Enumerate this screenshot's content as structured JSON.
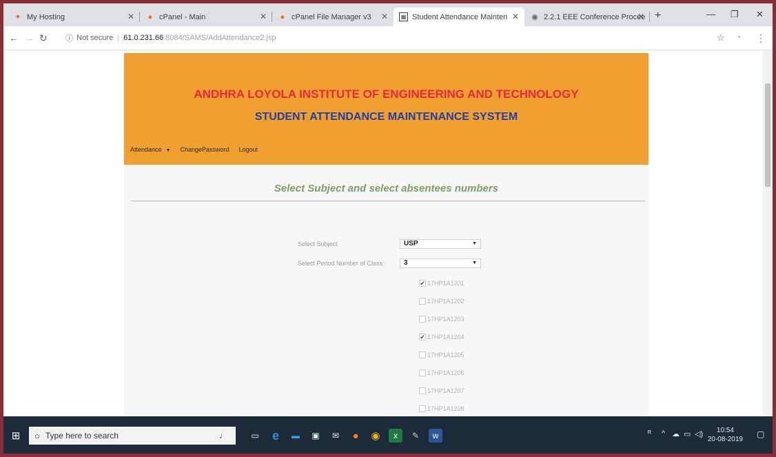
{
  "browser": {
    "tabs": [
      {
        "title": "My Hosting",
        "icon": "hosting-icon"
      },
      {
        "title": "cPanel - Main",
        "icon": "cpanel-icon"
      },
      {
        "title": "cPanel File Manager v3",
        "icon": "cpanel-icon"
      },
      {
        "title": "Student Attendance Mainten",
        "icon": "page-icon"
      },
      {
        "title": "2.2.1 EEE Conference Procee",
        "icon": "globe-icon"
      }
    ],
    "address": {
      "security": "Not secure",
      "host": "61.0.231.66",
      "rest": ":8084/SAMS/AddAttendance2.jsp"
    }
  },
  "page": {
    "institute": "ANDHRA LOYOLA INSTITUTE OF ENGINEERING AND TECHNOLOGY",
    "system": "STUDENT ATTENDANCE MAINTENANCE SYSTEM",
    "menu": {
      "attendance": "Attendance",
      "change_password": "ChangePassword",
      "logout": "Logout"
    },
    "title": "Select Subject and select absentees numbers",
    "subject_label": "Select Subject",
    "subject_value": "USP",
    "period_label": "Select Period Number of Class:",
    "period_value": "3",
    "students": [
      {
        "id": "17HP1A1201",
        "checked": true
      },
      {
        "id": "17HP1A1202",
        "checked": false
      },
      {
        "id": "17HP1A1203",
        "checked": false
      },
      {
        "id": "17HP1A1204",
        "checked": true
      },
      {
        "id": "17HP1A1205",
        "checked": false
      },
      {
        "id": "17HP1A1206",
        "checked": false
      },
      {
        "id": "17HP1A1207",
        "checked": false
      },
      {
        "id": "17HP1A1208",
        "checked": false
      }
    ]
  },
  "taskbar": {
    "search_placeholder": "Type here to search",
    "time": "10:54",
    "date": "20-08-2019"
  },
  "colors": {
    "header_bg": "#f0a030",
    "institute_text": "#e8263c",
    "system_text": "#1f3fa8",
    "title_text": "#7e9b6c"
  }
}
